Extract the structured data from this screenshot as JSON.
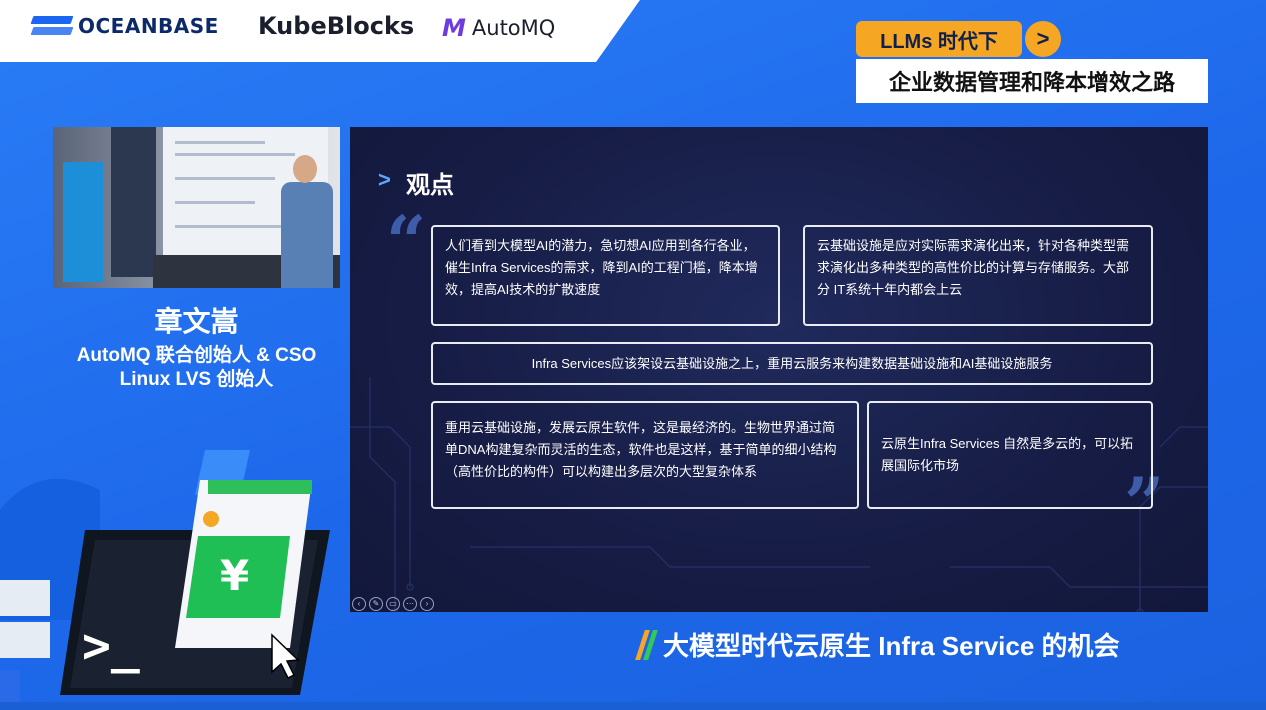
{
  "header": {
    "logos": [
      "OCEANBASE",
      "KubeBlocks",
      "AutoMQ"
    ],
    "badge": "LLMs 时代下",
    "badge_arrow": ">",
    "subtitle": "企业数据管理和降本增效之路"
  },
  "speaker": {
    "name": "章文嵩",
    "roles": [
      "AutoMQ 联合创始人 & CSO",
      "Linux LVS 创始人"
    ]
  },
  "slide": {
    "heading_marker": ">",
    "heading": "观点",
    "boxes": [
      "人们看到大模型AI的潜力，急切想AI应用到各行各业，催生Infra Services的需求，降到AI的工程门槛，降本增效，提高AI技术的扩散速度",
      "云基础设施是应对实际需求演化出来，针对各种类型需求演化出多种类型的高性价比的计算与存储服务。大部分 IT系统十年内都会上云",
      "Infra Services应该架设云基础设施之上，重用云服务来构建数据基础设施和AI基础设施服务",
      "重用云基础设施，发展云原生软件，这是最经济的。生物世界通过简单DNA构建复杂而灵活的生态，软件也是这样，基于简单的细小结构（高性价比的构件）可以构建出多层次的大型复杂体系",
      "云原生Infra Services 自然是多云的，可以拓展国际化市场"
    ],
    "open_quote": "“",
    "close_quote": "”"
  },
  "deco": {
    "currency_symbol": "¥",
    "prompt_symbol": ">_"
  },
  "footer": {
    "talk_title": "大模型时代云原生  Infra Service 的机会",
    "slash_colors": [
      "#f5a623",
      "#34c759"
    ]
  },
  "colors": {
    "background": "#1f6ff0",
    "badge": "#f5a623",
    "slide_bg": "#161c44"
  }
}
